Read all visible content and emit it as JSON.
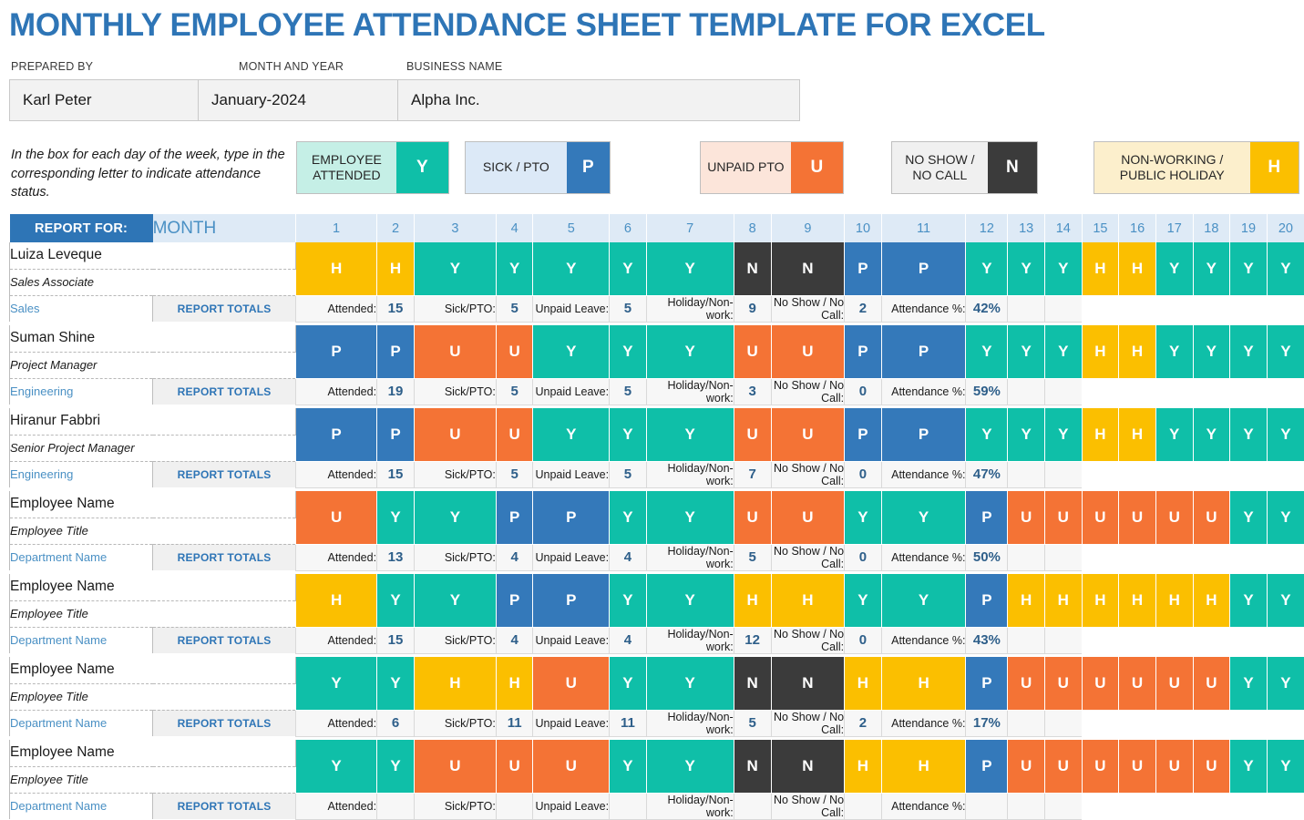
{
  "document": {
    "title": "MONTHLY EMPLOYEE ATTENDANCE SHEET TEMPLATE FOR EXCEL",
    "accent_color": "#2E75B6"
  },
  "meta": {
    "fields": [
      {
        "label": "PREPARED BY",
        "value": "Karl Peter"
      },
      {
        "label": "MONTH AND YEAR",
        "value": "January-2024"
      },
      {
        "label": "BUSINESS NAME",
        "value": "Alpha Inc."
      }
    ]
  },
  "legend": {
    "instruction": "In the box for each day of the week, type in the corresponding letter to indicate attendance status.",
    "items": [
      {
        "label": "EMPLOYEE ATTENDED",
        "code": "Y",
        "bg": "#C5EFE6",
        "code_bg": "#0FBFA8"
      },
      {
        "label": "SICK / PTO",
        "code": "P",
        "bg": "#DCE9F7",
        "code_bg": "#3479BA"
      },
      {
        "label": "UNPAID PTO",
        "code": "U",
        "bg": "#FCE5DA",
        "code_bg": "#F47335"
      },
      {
        "label": "NO SHOW / NO CALL",
        "code": "N",
        "bg": "#F0F0F0",
        "code_bg": "#3B3B3B"
      },
      {
        "label": "NON-WORKING / PUBLIC HOLIDAY",
        "code": "H",
        "bg": "#FCEFCC",
        "code_bg": "#FBBF00"
      }
    ]
  },
  "table": {
    "report_for_label": "REPORT FOR:",
    "month_label": "MONTH",
    "report_totals_label": "REPORT TOTALS",
    "days": [
      "1",
      "2",
      "3",
      "4",
      "5",
      "6",
      "7",
      "8",
      "9",
      "10",
      "11",
      "12",
      "13",
      "14",
      "15",
      "16",
      "17",
      "18",
      "19",
      "20"
    ],
    "totals_labels": {
      "attended": "Attended:",
      "sick": "Sick/PTO:",
      "unpaid": "Unpaid Leave:",
      "holiday": "Holiday/Non-work:",
      "noshow": "No Show / No Call:",
      "percent": "Attendance %:"
    },
    "employees": [
      {
        "name": "Luiza Leveque",
        "title": "Sales Associate",
        "department": "Sales",
        "attendance": [
          "H",
          "H",
          "Y",
          "Y",
          "Y",
          "Y",
          "Y",
          "N",
          "N",
          "P",
          "P",
          "Y",
          "Y",
          "Y",
          "H",
          "H",
          "Y",
          "Y",
          "Y",
          "Y"
        ],
        "totals": {
          "attended": "15",
          "sick": "5",
          "unpaid": "5",
          "holiday": "9",
          "noshow": "2",
          "percent": "42%"
        }
      },
      {
        "name": "Suman Shine",
        "title": "Project Manager",
        "department": "Engineering",
        "attendance": [
          "P",
          "P",
          "U",
          "U",
          "Y",
          "Y",
          "Y",
          "U",
          "U",
          "P",
          "P",
          "Y",
          "Y",
          "Y",
          "H",
          "H",
          "Y",
          "Y",
          "Y",
          "Y"
        ],
        "totals": {
          "attended": "19",
          "sick": "5",
          "unpaid": "5",
          "holiday": "3",
          "noshow": "0",
          "percent": "59%"
        }
      },
      {
        "name": "Hiranur Fabbri",
        "title": "Senior Project Manager",
        "department": "Engineering",
        "attendance": [
          "P",
          "P",
          "U",
          "U",
          "Y",
          "Y",
          "Y",
          "U",
          "U",
          "P",
          "P",
          "Y",
          "Y",
          "Y",
          "H",
          "H",
          "Y",
          "Y",
          "Y",
          "Y"
        ],
        "totals": {
          "attended": "15",
          "sick": "5",
          "unpaid": "5",
          "holiday": "7",
          "noshow": "0",
          "percent": "47%"
        }
      },
      {
        "name": "Employee Name",
        "title": "Employee Title",
        "department": "Department Name",
        "attendance": [
          "U",
          "Y",
          "Y",
          "P",
          "P",
          "Y",
          "Y",
          "U",
          "U",
          "Y",
          "Y",
          "P",
          "U",
          "U",
          "U",
          "U",
          "U",
          "U",
          "Y",
          "Y"
        ],
        "totals": {
          "attended": "13",
          "sick": "4",
          "unpaid": "4",
          "holiday": "5",
          "noshow": "0",
          "percent": "50%"
        }
      },
      {
        "name": "Employee Name",
        "title": "Employee Title",
        "department": "Department Name",
        "attendance": [
          "H",
          "Y",
          "Y",
          "P",
          "P",
          "Y",
          "Y",
          "H",
          "H",
          "Y",
          "Y",
          "P",
          "H",
          "H",
          "H",
          "H",
          "H",
          "H",
          "Y",
          "Y"
        ],
        "totals": {
          "attended": "15",
          "sick": "4",
          "unpaid": "4",
          "holiday": "12",
          "noshow": "0",
          "percent": "43%"
        }
      },
      {
        "name": "Employee Name",
        "title": "Employee Title",
        "department": "Department Name",
        "attendance": [
          "Y",
          "Y",
          "H",
          "H",
          "U",
          "Y",
          "Y",
          "N",
          "N",
          "H",
          "H",
          "P",
          "U",
          "U",
          "U",
          "U",
          "U",
          "U",
          "Y",
          "Y"
        ],
        "totals": {
          "attended": "6",
          "sick": "11",
          "unpaid": "11",
          "holiday": "5",
          "noshow": "2",
          "percent": "17%"
        }
      },
      {
        "name": "Employee Name",
        "title": "Employee Title",
        "department": "Department Name",
        "attendance": [
          "Y",
          "Y",
          "U",
          "U",
          "U",
          "Y",
          "Y",
          "N",
          "N",
          "H",
          "H",
          "P",
          "U",
          "U",
          "U",
          "U",
          "U",
          "U",
          "Y",
          "Y"
        ],
        "totals": {
          "attended": "",
          "sick": "",
          "unpaid": "",
          "holiday": "",
          "noshow": "",
          "percent": ""
        }
      }
    ]
  }
}
